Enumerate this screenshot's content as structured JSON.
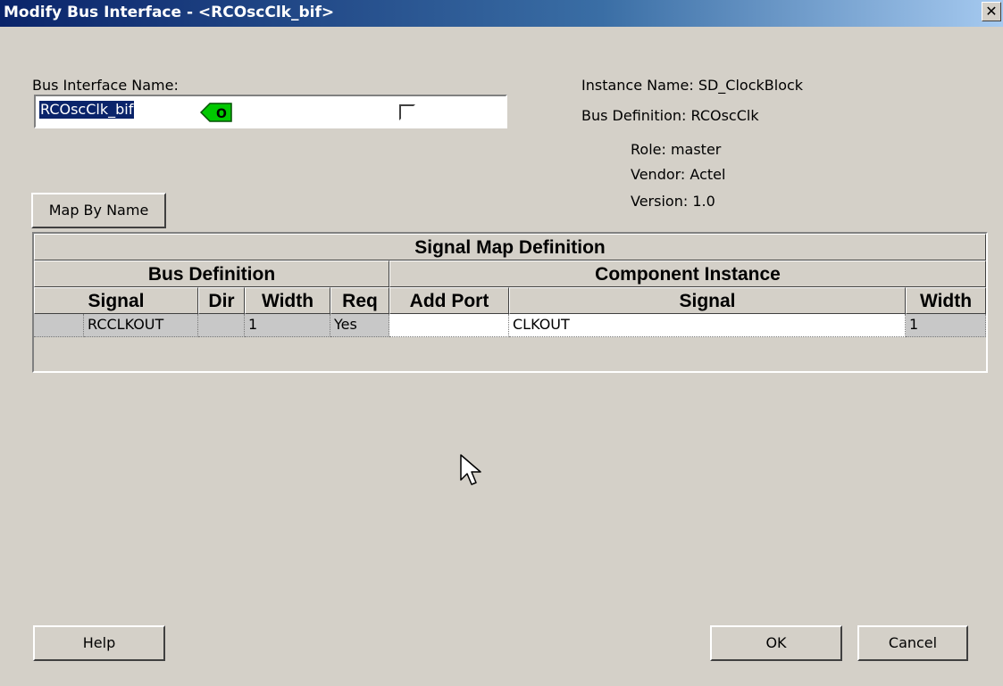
{
  "window": {
    "title": "Modify Bus Interface - <RCOscClk_bif>",
    "close_glyph": "✕"
  },
  "form": {
    "bus_interface_label": "Bus Interface Name:",
    "bus_interface_value": "RCOscClk_bif",
    "instance_name": "Instance Name: SD_ClockBlock",
    "bus_definition": "Bus Definition: RCOscClk",
    "role": "Role: master",
    "vendor": "Vendor: Actel",
    "version": "Version: 1.0"
  },
  "buttons": {
    "map_by_name": "Map By Name",
    "help": "Help",
    "ok": "OK",
    "cancel": "Cancel"
  },
  "table": {
    "title": "Signal Map Definition",
    "group_bus": "Bus Definition",
    "group_component": "Component Instance",
    "columns": {
      "signal": "Signal",
      "dir": "Dir",
      "width": "Width",
      "req": "Req",
      "add_port": "Add Port",
      "comp_signal": "Signal",
      "comp_width": "Width"
    },
    "rows": [
      {
        "signal": "RCCLKOUT",
        "dir": "O",
        "width": "1",
        "req": "Yes",
        "add_port": false,
        "comp_signal": "CLKOUT",
        "comp_width": "1"
      }
    ]
  },
  "colors": {
    "dir_icon_fill": "#00c800",
    "selection": "#0a246a",
    "dialog_bg": "#d4d0c8"
  },
  "icons": [
    "close-icon",
    "output-direction-icon",
    "mouse-cursor-icon"
  ]
}
